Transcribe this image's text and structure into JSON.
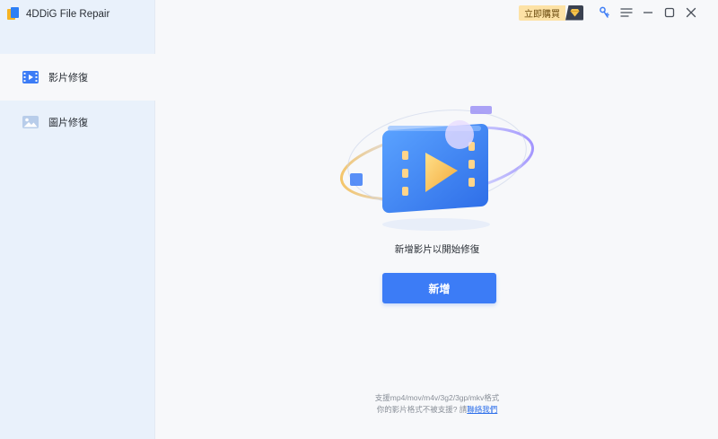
{
  "app": {
    "title": "4DDiG File Repair"
  },
  "titlebar": {
    "buy_label": "立即購買"
  },
  "sidebar": {
    "items": [
      {
        "label": "影片修復",
        "icon": "video-icon",
        "active": true
      },
      {
        "label": "圖片修復",
        "icon": "image-icon",
        "active": false
      }
    ]
  },
  "main": {
    "hint": "新增影片以開始修復",
    "add_label": "新增",
    "supported_formats": "支援mp4/mov/m4v/3g2/3gp/mkv格式",
    "unsupported_prefix": "你的影片格式不被支援? 請",
    "contact_label": "聯絡我們"
  },
  "colors": {
    "accent": "#3c7cf6",
    "sidebar_bg": "#e9f1fb",
    "link": "#2d6fea",
    "buy_bg": "#fde2a6"
  }
}
